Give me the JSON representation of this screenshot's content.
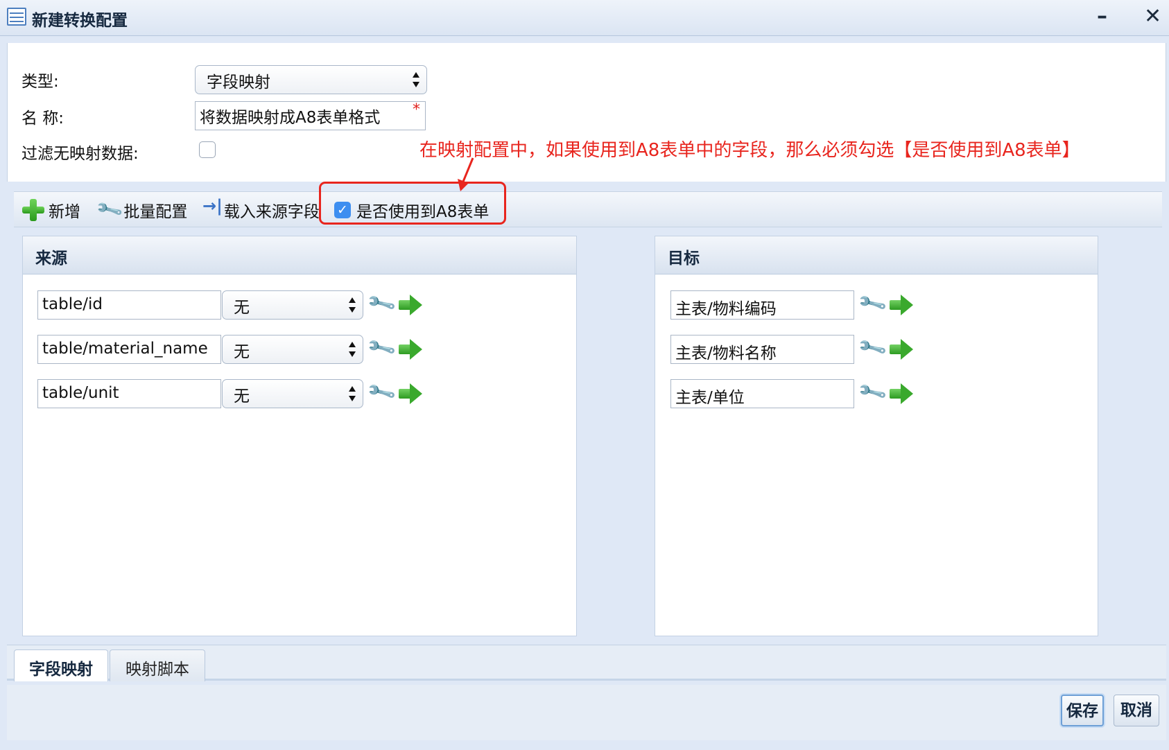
{
  "window": {
    "title": "新建转换配置",
    "minimize_label": "–",
    "close_label": "✕"
  },
  "form": {
    "type_label": "类型:",
    "type_value": "字段映射",
    "name_label": "名 称:",
    "name_value": "将数据映射成A8表单格式",
    "name_required_mark": "*",
    "filter_label": "过滤无映射数据:",
    "filter_checked": false
  },
  "annotation": {
    "text": "在映射配置中，如果使用到A8表单中的字段，那么必须勾选【是否使用到A8表单】",
    "color": "#e8251e"
  },
  "toolbar": {
    "add_label": "新增",
    "batch_label": "批量配置",
    "load_label": "载入来源字段",
    "use_a8_label": "是否使用到A8表单",
    "use_a8_checked": true,
    "use_a8_check_glyph": "✓"
  },
  "source_panel": {
    "title": "来源",
    "rows": [
      {
        "field": "table/id",
        "select": "无"
      },
      {
        "field": "table/material_name",
        "select": "无"
      },
      {
        "field": "table/unit",
        "select": "无"
      }
    ]
  },
  "target_panel": {
    "title": "目标",
    "rows": [
      {
        "field": "主表/物料编码"
      },
      {
        "field": "主表/物料名称"
      },
      {
        "field": "主表/单位"
      }
    ]
  },
  "tabs": [
    {
      "label": "字段映射",
      "active": true
    },
    {
      "label": "映射脚本",
      "active": false
    }
  ],
  "footer": {
    "save_label": "保存",
    "cancel_label": "取消"
  },
  "icons": {
    "wrench": "wrench-icon",
    "arrow": "green-arrow-icon",
    "plus": "green-plus-icon"
  }
}
